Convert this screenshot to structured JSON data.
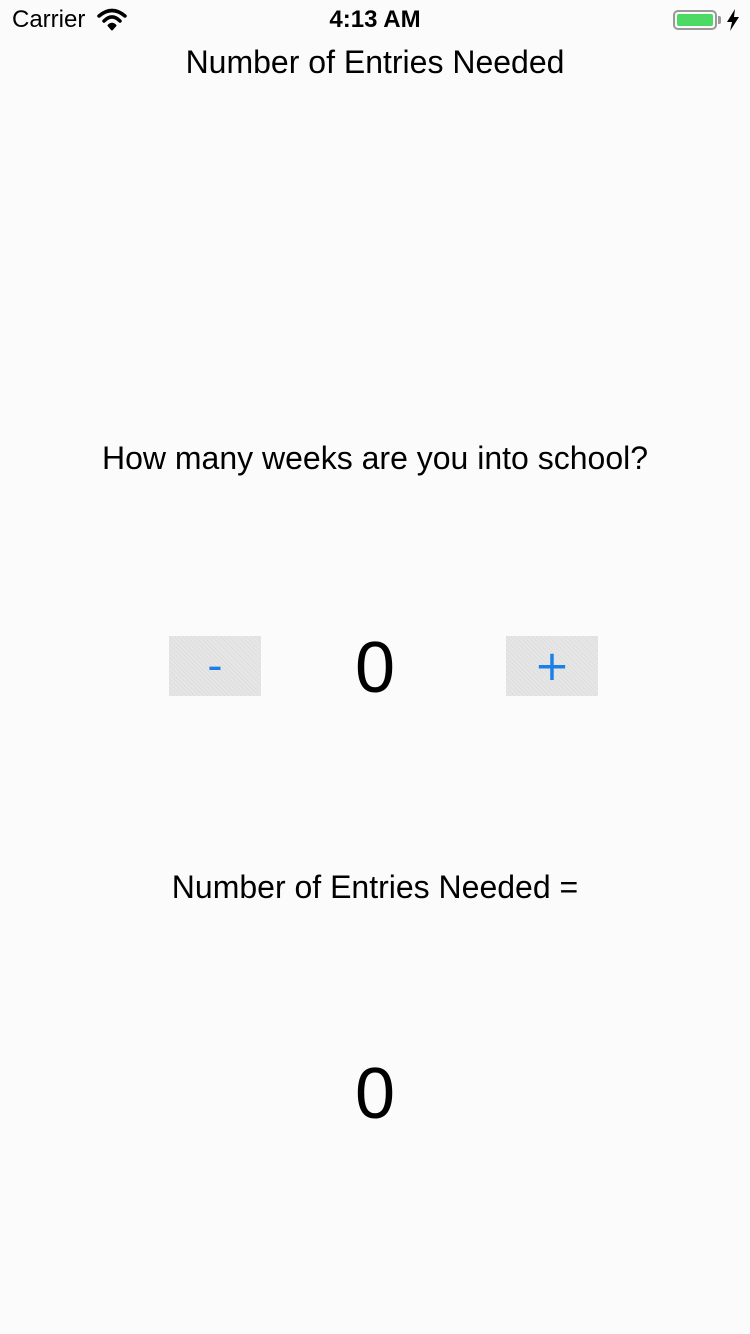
{
  "status_bar": {
    "carrier": "Carrier",
    "time": "4:13 AM",
    "battery_color": "#4cd964",
    "icons": [
      "wifi-icon",
      "battery-icon",
      "charging-bolt-icon"
    ]
  },
  "page": {
    "title": "Number of Entries Needed"
  },
  "stepper": {
    "question": "How many weeks are you into school?",
    "minus_label": "-",
    "plus_label": "+",
    "value": "0",
    "button_text_color": "#1a7fe6"
  },
  "result": {
    "label": "Number of Entries Needed =",
    "value": "0"
  }
}
